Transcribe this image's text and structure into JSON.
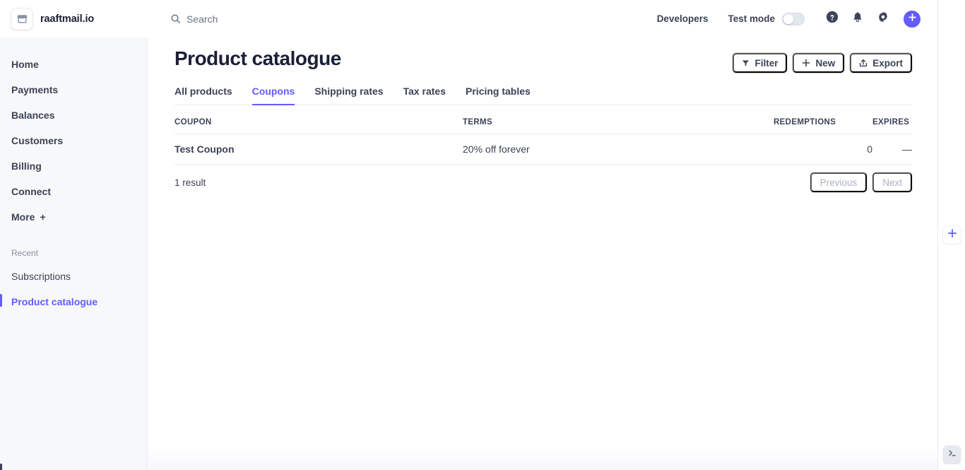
{
  "topbar": {
    "brand_name": "raaftmail.io",
    "brand_logo_icon": "storefront-icon",
    "search_placeholder": "Search",
    "search_icon": "search-icon",
    "developers_label": "Developers",
    "test_mode_label": "Test mode",
    "test_mode_enabled": false,
    "help_icon": "help-circle-icon",
    "notifications_icon": "bell-icon",
    "settings_icon": "gear-icon",
    "add_icon": "plus-circle-icon"
  },
  "sidebar": {
    "items": [
      {
        "label": "Home"
      },
      {
        "label": "Payments"
      },
      {
        "label": "Balances"
      },
      {
        "label": "Customers"
      },
      {
        "label": "Billing"
      },
      {
        "label": "Connect"
      },
      {
        "label": "More",
        "suffix": "+"
      }
    ],
    "recent_heading": "Recent",
    "recent": [
      {
        "label": "Subscriptions",
        "active": false
      },
      {
        "label": "Product catalogue",
        "active": true
      }
    ]
  },
  "page": {
    "title": "Product catalogue",
    "actions": [
      {
        "label": "Filter",
        "icon": "filter-icon"
      },
      {
        "label": "New",
        "icon": "plus-icon"
      },
      {
        "label": "Export",
        "icon": "export-icon"
      }
    ],
    "tabs": [
      {
        "label": "All products",
        "active": false
      },
      {
        "label": "Coupons",
        "active": true
      },
      {
        "label": "Shipping rates",
        "active": false
      },
      {
        "label": "Tax rates",
        "active": false
      },
      {
        "label": "Pricing tables",
        "active": false
      }
    ]
  },
  "table": {
    "columns": [
      "COUPON",
      "TERMS",
      "REDEMPTIONS",
      "EXPIRES"
    ],
    "rows": [
      {
        "coupon": "Test Coupon",
        "terms": "20% off forever",
        "redemptions": "0",
        "expires": "—"
      }
    ],
    "result_count": "1 result",
    "pagination": {
      "previous_label": "Previous",
      "next_label": "Next",
      "previous_disabled": true,
      "next_disabled": true
    }
  },
  "right_rail": {
    "add_icon": "plus-icon",
    "terminal_icon": "terminal-icon"
  },
  "colors": {
    "accent": "#635bff",
    "text_primary": "#1a1f36",
    "text_secondary": "#3c4257",
    "text_muted": "#697386",
    "sidebar_bg": "#f7f8fa",
    "border": "#e8ebf0"
  }
}
